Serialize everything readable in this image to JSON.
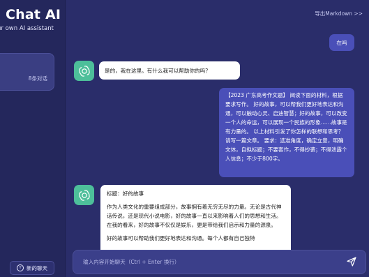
{
  "sidebar": {
    "brand_title": "Chat AI",
    "brand_subtitle": "ur own AI assistant",
    "conversation_count": "8条对话",
    "new_chat_label": "新的聊天"
  },
  "header": {
    "export_label": "导出Markdown >>"
  },
  "messages": [
    {
      "role": "user",
      "text": "在吗"
    },
    {
      "role": "assistant",
      "text": "是的，我在这里。有什么我可以帮助你的吗？"
    },
    {
      "role": "user",
      "text": "【2023 广东高考作文题】 阅读下面的材料，根据要求写作。 好的故事，可以帮我们更好地表达和沟通，可以触动心灵、启迪智慧；好的故事，可以改变一个人的命运，可以展现一个民族的形象……故事是有力量的。 以上材料引发了你怎样的联想和思考？请写一篇文章。 要求：选准角度，确定立意，明确文体，自拟标题；不要套作，不得抄袭；不得泄露个人信息；不少于800字。"
    },
    {
      "role": "assistant",
      "paragraphs": [
        "标题：好的故事",
        "作为人类文化的重要组成部分，故事拥有着无穷无尽的力量。无论是古代神话传说，还是现代小说电影，好的故事一直以来影响着人们的思想和生活。在我的看来，好的故事不仅仅是娱乐，更是带给我们启示和力量的源泉。",
        "好的故事可以帮助我们更好地表达和沟通。每个人都有自己独特"
      ]
    }
  ],
  "input": {
    "placeholder": "输入内容开始聊天（Ctrl + Enter 换行）"
  },
  "colors": {
    "background": "#2a2d6a",
    "user_bubble": "#4a4fb8",
    "avatar": "#4dbf9a"
  },
  "icons": [
    "openai-logo-icon",
    "plus-circle-icon",
    "send-icon"
  ]
}
